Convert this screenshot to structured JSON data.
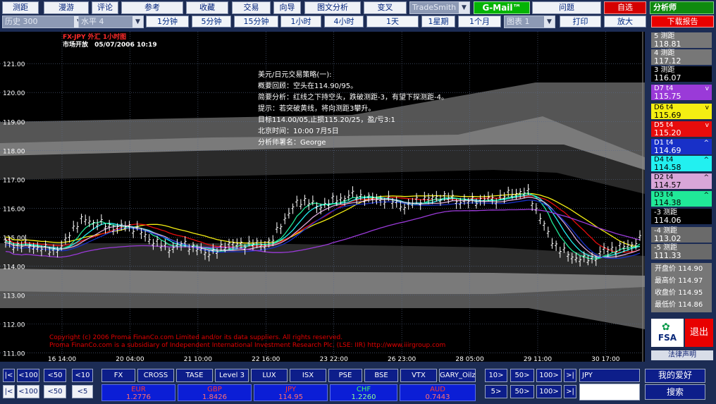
{
  "toolbar": {
    "row1": [
      "测距",
      "漫游",
      "评论",
      "参考",
      "收藏",
      "交易",
      "向导",
      "图文分析",
      "变叉"
    ],
    "source_select": "TradeSmith",
    "gmail": "G-Mail™",
    "question": "问题",
    "self_select": "自选",
    "analyst": "分析师",
    "history_select": "历史 300",
    "level_select": "水平 4",
    "periods": [
      "1分钟",
      "5分钟",
      "15分钟",
      "1小时",
      "4小时",
      "1天",
      "1星期",
      "1个月"
    ],
    "chart_select": "图表 1",
    "print": "打印",
    "zoom": "放大",
    "download": "下载报告"
  },
  "chart_header": {
    "symbol_line": "FX-JPY 外汇 1小时图",
    "status": "市场开放",
    "datetime": "05/07/2006 10:19"
  },
  "commentary": [
    "美元/日元交易策略(一):",
    "概要回顾：空头在114.90/95。",
    "简要分析：红线之下持空头，跌破测距-3，有望下探测距-4。",
    "提示：若突破黄线，将向测距3攀升。",
    "目标114.00/05,止损115.20/25，盈/亏3:1",
    "北京时间：10:00  7月5日",
    "分析师署名：George"
  ],
  "copyright": [
    "Copyright (c) 2006 Proma FinanCo.com Limited and/or its data suppliers. All rights reserved.",
    "Proma FinanCo.com is a subsidiary of Independent International Investment Research Plc. (LSE: IIR) http://www.iiirgroup.com"
  ],
  "chart_data": {
    "type": "candlestick",
    "y_ticks": [
      "121.00",
      "120.00",
      "119.00",
      "118.00",
      "117.00",
      "116.00",
      "115.00",
      "114.00",
      "113.00",
      "112.00",
      "111.00"
    ],
    "ylim": [
      110.7,
      122.1
    ],
    "x_ticks": [
      "16 14:00",
      "20 04:00",
      "21 10:00",
      "22 16:00",
      "23 22:00",
      "26 23:00",
      "28 05:00",
      "29 11:00",
      "30 17:00"
    ],
    "price_path": [
      114.8,
      114.7,
      114.75,
      114.6,
      114.55,
      114.6,
      115.3,
      115.6,
      115.5,
      115.4,
      115.3,
      115.4,
      115.2,
      114.9,
      114.7,
      114.6,
      114.8,
      114.6,
      114.45,
      114.5,
      114.8,
      114.7,
      114.8,
      114.7,
      114.9,
      115.6,
      116.1,
      116.3,
      116.0,
      116.2,
      116.3,
      116.45,
      116.4,
      116.3,
      116.3,
      116.2,
      116.0,
      116.3,
      116.3,
      116.4,
      116.35,
      116.2,
      116.25,
      116.3,
      116.3,
      116.45,
      116.55,
      116.5,
      115.7,
      114.9,
      114.5,
      114.3,
      114.2,
      114.3,
      114.6,
      114.6,
      114.7,
      114.9
    ],
    "levels": [
      {
        "label": "5 测距",
        "value": "118.81"
      },
      {
        "label": "4 测距",
        "value": "117.12"
      },
      {
        "label": "3 测距",
        "value": "116.07"
      },
      {
        "label": "D7 t4",
        "value": "115.75",
        "color": "#9a3ad8"
      },
      {
        "label": "D6 t4",
        "value": "115.69",
        "color": "#f4ee12"
      },
      {
        "label": "D5 t4",
        "value": "115.20",
        "color": "#e80c0c"
      },
      {
        "label": "D1 t4",
        "value": "114.69",
        "color": "#1830c8"
      },
      {
        "label": "D4 t4",
        "value": "114.58",
        "color": "#22f0f0"
      },
      {
        "label": "D2 t4",
        "value": "114.57",
        "color": "#d8a6d8"
      },
      {
        "label": "D3 t4",
        "value": "114.38",
        "color": "#20e898"
      },
      {
        "label": "-3 测距",
        "value": "114.06"
      },
      {
        "label": "-4 测距",
        "value": "113.02"
      },
      {
        "label": "-5 测距",
        "value": "111.33"
      }
    ],
    "stats": [
      {
        "label": "开盘价",
        "value": "114.90"
      },
      {
        "label": "最高价",
        "value": "114.97"
      },
      {
        "label": "收盘价",
        "value": "114.95"
      },
      {
        "label": "最低价",
        "value": "114.86"
      }
    ]
  },
  "side": {
    "fsa": "FSA",
    "exit": "退出",
    "legal": "法律声明"
  },
  "bottom": {
    "nav_top": [
      "|<",
      "<100",
      "<50",
      "<10"
    ],
    "tabs": [
      "FX",
      "CROSS",
      "TASE",
      "Level 3",
      "LUX",
      "ISX",
      "PSE",
      "BSE",
      "VTX",
      "GARY_Oilz"
    ],
    "nav_right_top": [
      "10>",
      "50>",
      "100>",
      ">|"
    ],
    "symbol_input": "JPY",
    "favorites": "我的爱好",
    "nav_bottom": [
      "|<",
      "<100",
      "<50",
      "<5"
    ],
    "currencies": [
      {
        "name": "EUR",
        "value": "1.2776"
      },
      {
        "name": "GBP",
        "value": "1.8426"
      },
      {
        "name": "JPY",
        "value": "114.95"
      },
      {
        "name": "CHF",
        "value": "1.2260"
      },
      {
        "name": "AUD",
        "value": "0.7443"
      }
    ],
    "nav_right_bottom": [
      "5>",
      "50>",
      "100>",
      ">|"
    ],
    "search": "搜索"
  },
  "colors": {
    "gmail_bg": "#05b405",
    "self_bg": "#d40000",
    "download_bg": "#e80000",
    "analyst_bg": "#0f8a0f"
  }
}
